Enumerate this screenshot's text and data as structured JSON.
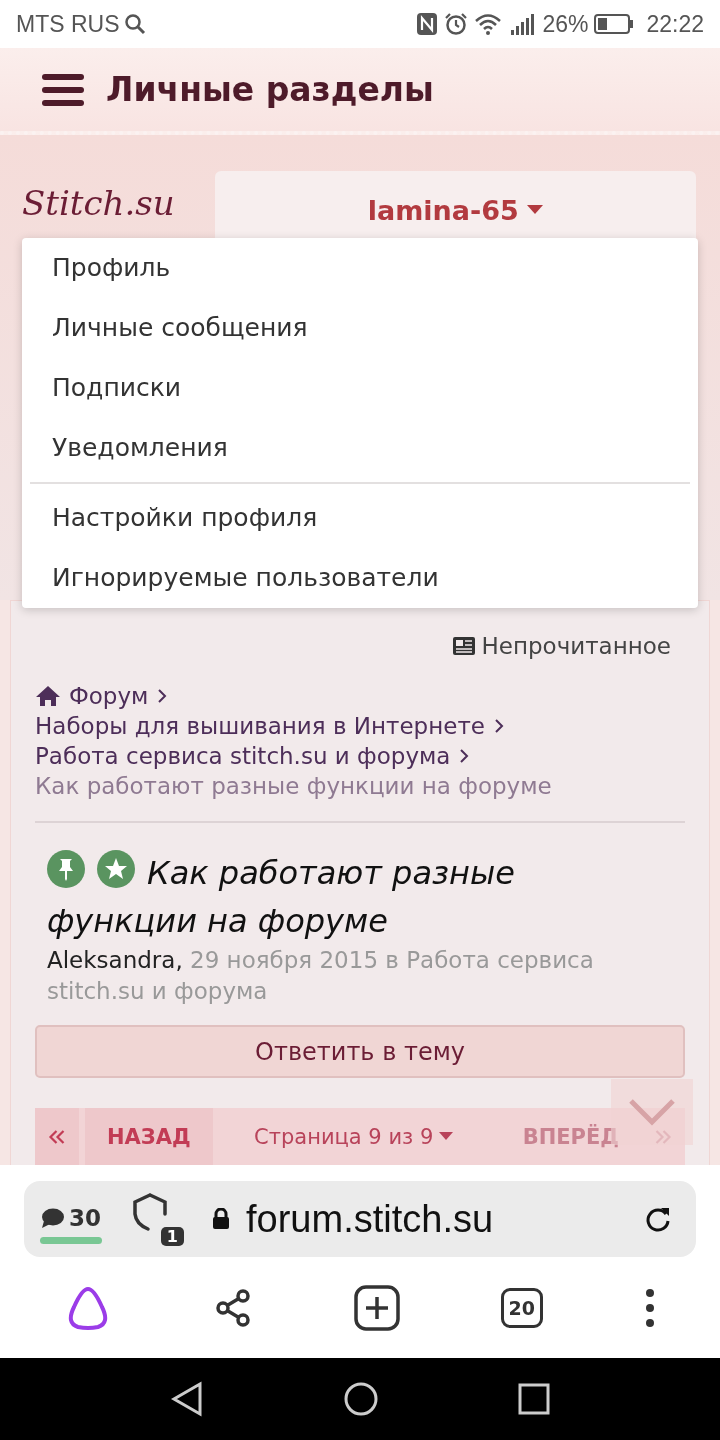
{
  "status_bar": {
    "carrier": "MTS RUS",
    "battery": "26%",
    "time": "22:22"
  },
  "header": {
    "title": "Личные разделы"
  },
  "logo": "Stitch.su",
  "user_menu": {
    "username": "lamina-65",
    "expanded": true,
    "groups": [
      [
        {
          "label": "Профиль"
        },
        {
          "label": "Личные сообщения"
        },
        {
          "label": "Подписки"
        },
        {
          "label": "Уведомления"
        }
      ],
      [
        {
          "label": "Настройки профиля"
        },
        {
          "label": "Игнорируемые пользователи"
        }
      ]
    ]
  },
  "unread_link": "Непрочитанное",
  "breadcrumbs": [
    {
      "label": "Форум",
      "kind": "home"
    },
    {
      "label": "Наборы для вышивания в Интернете",
      "kind": "link"
    },
    {
      "label": "Работа сервиса stitch.su и форума",
      "kind": "link"
    },
    {
      "label": "Как работают разные функции на форуме",
      "kind": "current"
    }
  ],
  "thread": {
    "title": "Как работают разные функции на форуме",
    "pinned": true,
    "featured": true,
    "author": "Aleksandra,",
    "meta": "29 ноября 2015 в Работа сервиса stitch.su и форума"
  },
  "reply_button": "Ответить в тему",
  "pagination": {
    "prev_label": "НАЗАД",
    "page_label": "Страница 9 из 9",
    "next_label": "ВПЕРЁД",
    "prev_disabled": false,
    "next_disabled": true
  },
  "browser": {
    "comments_count": "30",
    "protect_count": "1",
    "url": "forum.stitch.su",
    "tabs_count": "20"
  }
}
